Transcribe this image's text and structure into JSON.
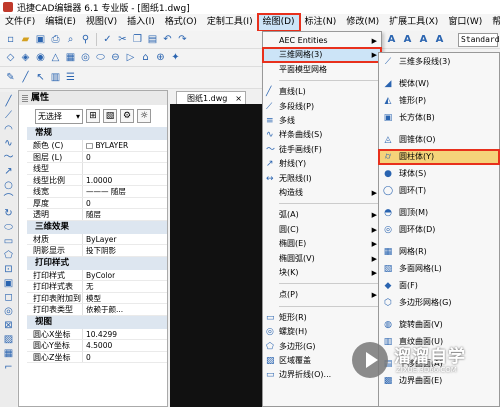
{
  "window": {
    "title": "迅捷CAD编辑器 6.1 专业版 - [图纸1.dwg]"
  },
  "menubar": [
    "文件(F)",
    "编辑(E)",
    "视图(V)",
    "插入(I)",
    "格式(O)",
    "定制工具(I)",
    "绘图(D)",
    "标注(N)",
    "修改(M)",
    "扩展工具(X)",
    "窗口(W)",
    "帮助(H)"
  ],
  "toolbar": {
    "style_value": "Standard",
    "icons": [
      "new-icon",
      "open-icon",
      "save-icon",
      "print-icon",
      "preview-icon",
      "find-icon",
      "spell-icon",
      "cut-icon",
      "copy-icon",
      "paste-icon"
    ]
  },
  "properties": {
    "title": "属性",
    "selection": "无选择",
    "sections": [
      {
        "name": "常规",
        "rows": [
          {
            "k": "颜色 (C)",
            "v": "□ BYLAYER"
          },
          {
            "k": "图层 (L)",
            "v": "0"
          },
          {
            "k": "线型",
            "v": ""
          },
          {
            "k": "线型比例",
            "v": "1.0000"
          },
          {
            "k": "线宽",
            "v": "——— 随层"
          },
          {
            "k": "厚度",
            "v": "0"
          },
          {
            "k": "透明",
            "v": "随层"
          }
        ]
      },
      {
        "name": "三维效果",
        "rows": [
          {
            "k": "材质",
            "v": "ByLayer"
          },
          {
            "k": "阴影显示",
            "v": "投下阴影"
          }
        ]
      },
      {
        "name": "打印样式",
        "rows": [
          {
            "k": "打印样式",
            "v": "ByColor"
          },
          {
            "k": "打印样式表",
            "v": "无"
          },
          {
            "k": "打印表附加到",
            "v": "模型"
          },
          {
            "k": "打印表类型",
            "v": "依赖于颜..."
          }
        ]
      },
      {
        "name": "视图",
        "rows": [
          {
            "k": "圆心X坐标",
            "v": "10.4299"
          },
          {
            "k": "圆心Y坐标",
            "v": "4.5000"
          },
          {
            "k": "圆心Z坐标",
            "v": "0"
          }
        ]
      }
    ]
  },
  "doc_tab": "图纸1.dwg",
  "draw_menu": [
    {
      "label": "AEC Entities",
      "arrow": true
    },
    {
      "label": "三维网格(3)",
      "arrow": true,
      "highlight": true
    },
    {
      "label": "平面模型网格",
      "arrow": false
    },
    {
      "label": "直线(L)",
      "arrow": false
    },
    {
      "label": "多段线(P)",
      "arrow": false
    },
    {
      "label": "多线",
      "arrow": false
    },
    {
      "label": "样条曲线(S)",
      "arrow": false
    },
    {
      "label": "徒手画线(F)",
      "arrow": false
    },
    {
      "label": "射线(Y)",
      "arrow": false
    },
    {
      "label": "无限线(I)",
      "arrow": false
    },
    {
      "label": "构造线",
      "arrow": true
    },
    {
      "label": "弧(A)",
      "arrow": true
    },
    {
      "label": "圆(C)",
      "arrow": true
    },
    {
      "label": "椭圆(E)",
      "arrow": true
    },
    {
      "label": "椭圆弧(V)",
      "arrow": true
    },
    {
      "label": "块(K)",
      "arrow": true
    },
    {
      "label": "点(P)",
      "arrow": true
    },
    {
      "label": "矩形(R)",
      "arrow": false
    },
    {
      "label": "螺旋(H)",
      "arrow": false
    },
    {
      "label": "多边形(G)",
      "arrow": false
    },
    {
      "label": "区域覆盖",
      "arrow": false
    },
    {
      "label": "边界折线(O)...",
      "arrow": false
    }
  ],
  "mesh_menu": [
    {
      "label": "三维多段线(3)"
    },
    {
      "label": "楔体(W)"
    },
    {
      "label": "锥形(P)"
    },
    {
      "label": "长方体(B)"
    },
    {
      "label": "圆锥体(O)"
    },
    {
      "label": "圆柱体(Y)",
      "highlight": true
    },
    {
      "label": "球体(S)"
    },
    {
      "label": "圆环(T)"
    },
    {
      "label": "圆顶(M)"
    },
    {
      "label": "圆环体(D)"
    },
    {
      "label": "网格(R)"
    },
    {
      "label": "多面网格(L)"
    },
    {
      "label": "面(F)"
    },
    {
      "label": "多边形网格(G)"
    },
    {
      "label": "旋转曲面(V)"
    },
    {
      "label": "直纹曲面(U)"
    },
    {
      "label": "平移曲面(A)"
    },
    {
      "label": "边界曲面(E)"
    }
  ],
  "watermark": {
    "title": "溜溜自学",
    "url": "ZIXUE.3D66.COM"
  }
}
